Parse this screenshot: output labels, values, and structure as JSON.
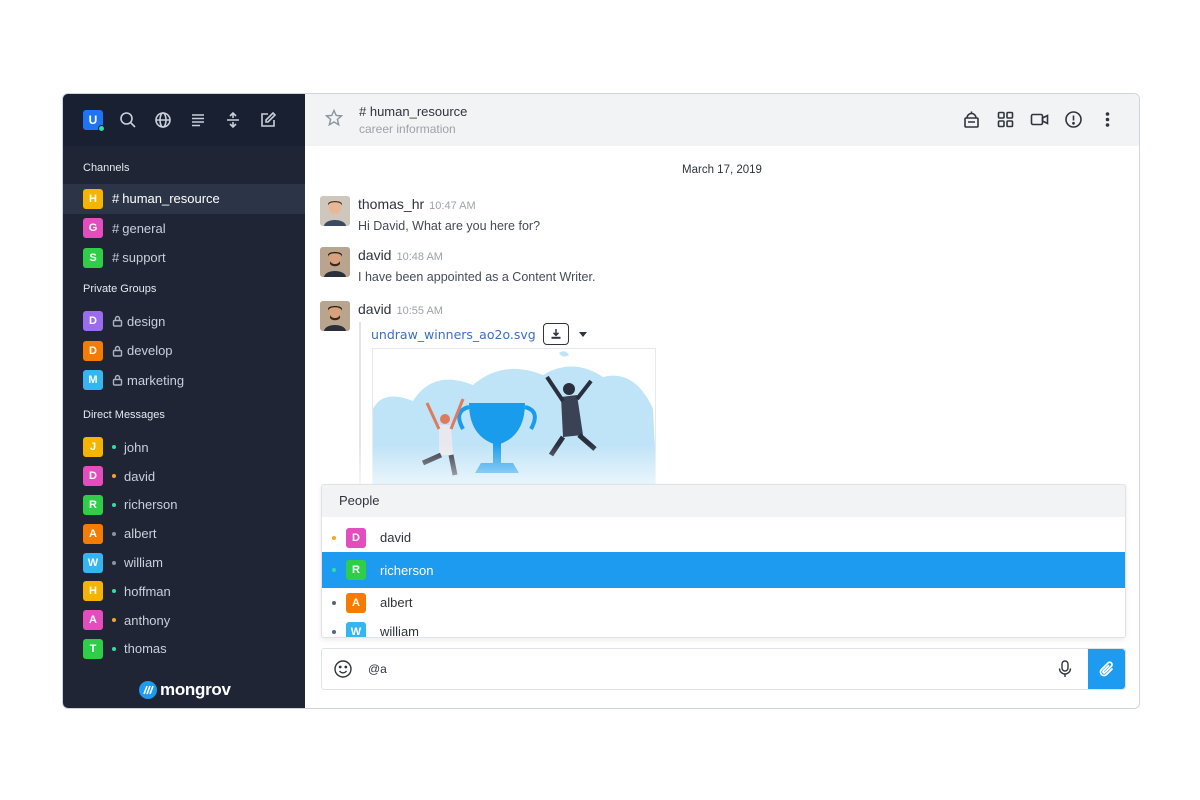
{
  "app": {
    "logo_letter": "U",
    "brand": "mongrov"
  },
  "sidebar": {
    "channels_title": "Channels",
    "channels": [
      {
        "letter": "H",
        "prefix": "#",
        "name": "human_resource",
        "color": "#f5b400",
        "active": true
      },
      {
        "letter": "G",
        "prefix": "#",
        "name": "general",
        "color": "#e44dbd"
      },
      {
        "letter": "S",
        "prefix": "#",
        "name": "support",
        "color": "#2fce48"
      }
    ],
    "groups_title": "Private Groups",
    "groups": [
      {
        "letter": "D",
        "name": "design",
        "color": "#9b6cf0"
      },
      {
        "letter": "D",
        "name": "develop",
        "color": "#f57c00"
      },
      {
        "letter": "M",
        "name": "marketing",
        "color": "#36b6f0"
      }
    ],
    "dm_title": "Direct Messages",
    "dms": [
      {
        "letter": "J",
        "name": "john",
        "color": "#f5b400",
        "status": "#2de0a5"
      },
      {
        "letter": "D",
        "name": "david",
        "color": "#e44dbd",
        "status": "#f5a623"
      },
      {
        "letter": "R",
        "name": "richerson",
        "color": "#2fce48",
        "status": "#2de0a5"
      },
      {
        "letter": "A",
        "name": "albert",
        "color": "#f57c00",
        "status": "#8a93a6"
      },
      {
        "letter": "W",
        "name": "william",
        "color": "#36b6f0",
        "status": "#8a93a6"
      },
      {
        "letter": "H",
        "name": "hoffman",
        "color": "#f5b400",
        "status": "#2de0a5"
      },
      {
        "letter": "A",
        "name": "anthony",
        "color": "#e44dbd",
        "status": "#f5a623"
      },
      {
        "letter": "T",
        "name": "thomas",
        "color": "#2fce48",
        "status": "#2de0a5"
      }
    ]
  },
  "header": {
    "title": "# human_resource",
    "topic": "career information"
  },
  "messages": {
    "date": "March 17, 2019",
    "items": [
      {
        "user": "thomas_hr",
        "time": "10:47 AM",
        "text": "Hi David, What are you here for?"
      },
      {
        "user": "david",
        "time": "10:48 AM",
        "text": "I have been appointed as a Content Writer."
      },
      {
        "user": "david",
        "time": "10:55 AM",
        "file": "undraw_winners_ao2o.svg"
      }
    ]
  },
  "popup": {
    "title": "People",
    "people": [
      {
        "letter": "D",
        "name": "david",
        "color": "#e44dbd",
        "status": "#f5a623"
      },
      {
        "letter": "R",
        "name": "richerson",
        "color": "#2fce48",
        "status": "#2de0a5",
        "selected": true
      },
      {
        "letter": "A",
        "name": "albert",
        "color": "#f57c00",
        "status": "#5b6478"
      },
      {
        "letter": "W",
        "name": "william",
        "color": "#36b6f0",
        "status": "#5b6478"
      }
    ]
  },
  "composer": {
    "value": "@a"
  },
  "colors": {
    "accent": "#1d9bf0",
    "sidebar_bg": "#1f2535"
  }
}
